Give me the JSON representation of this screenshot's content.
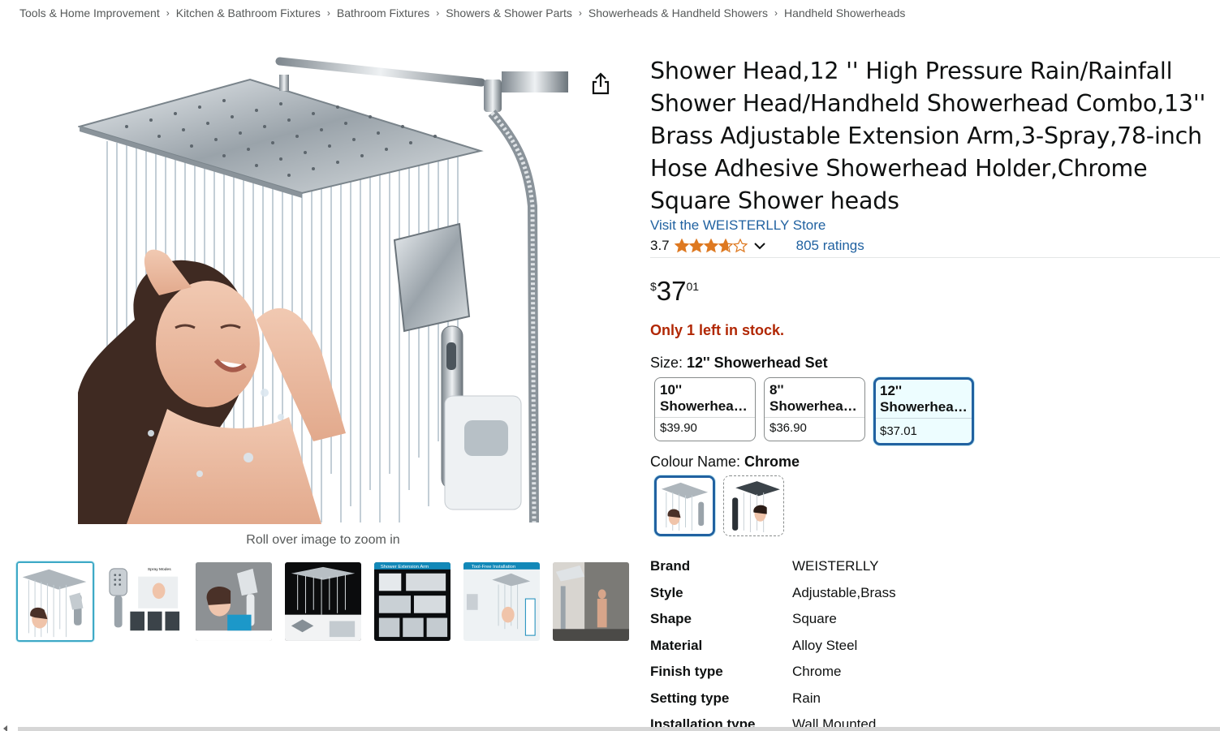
{
  "breadcrumb": [
    "Tools & Home Improvement",
    "Kitchen & Bathroom Fixtures",
    "Bathroom Fixtures",
    "Showers & Shower Parts",
    "Showerheads & Handheld Showers",
    "Handheld Showerheads"
  ],
  "breadcrumb_separator": "›",
  "gallery": {
    "zoom_hint": "Roll over image to zoom in",
    "thumbnail_captions": [
      "",
      "Spray Modes",
      "",
      "",
      "Shower Extension Arm",
      "Tool-Free Installation",
      ""
    ]
  },
  "product": {
    "title": "Shower Head,12 '' High Pressure Rain/Rainfall Shower Head/Handheld Showerhead Combo,13'' Brass Adjustable Extension Arm,3-Spray,78-inch Hose Adhesive Showerhead Holder,Chrome Square Shower heads",
    "store_link": "Visit the WEISTERLLY Store",
    "rating_value": "3.7",
    "rating_stars": 3.7,
    "ratings_count": "805 ratings",
    "price_symbol": "$",
    "price_whole": "37",
    "price_fraction": "01",
    "stock": "Only 1 left in stock."
  },
  "size": {
    "label": "Size: ",
    "selected": "12'' Showerhead Set",
    "options": [
      {
        "line1": "10''",
        "line2": "Showerhead Set",
        "price": "$39.90"
      },
      {
        "line1": "8''",
        "line2": "Showerhead Set",
        "price": "$36.90"
      },
      {
        "line1": "12''",
        "line2": "Showerhead Set",
        "price": "$37.01"
      }
    ]
  },
  "colour": {
    "label": "Colour Name: ",
    "selected": "Chrome"
  },
  "specs": [
    {
      "key": "Brand",
      "value": "WEISTERLLY"
    },
    {
      "key": "Style",
      "value": "Adjustable,Brass"
    },
    {
      "key": "Shape",
      "value": "Square"
    },
    {
      "key": "Material",
      "value": "Alloy Steel"
    },
    {
      "key": "Finish type",
      "value": "Chrome"
    },
    {
      "key": "Setting type",
      "value": "Rain"
    },
    {
      "key": "Installation type",
      "value": "Wall Mounted"
    }
  ],
  "colors": {
    "link": "#2162a1",
    "stock": "#b12704",
    "star": "#de7921",
    "selected_border": "#2162a1",
    "thumb_selected_border": "#3ea9c6"
  }
}
